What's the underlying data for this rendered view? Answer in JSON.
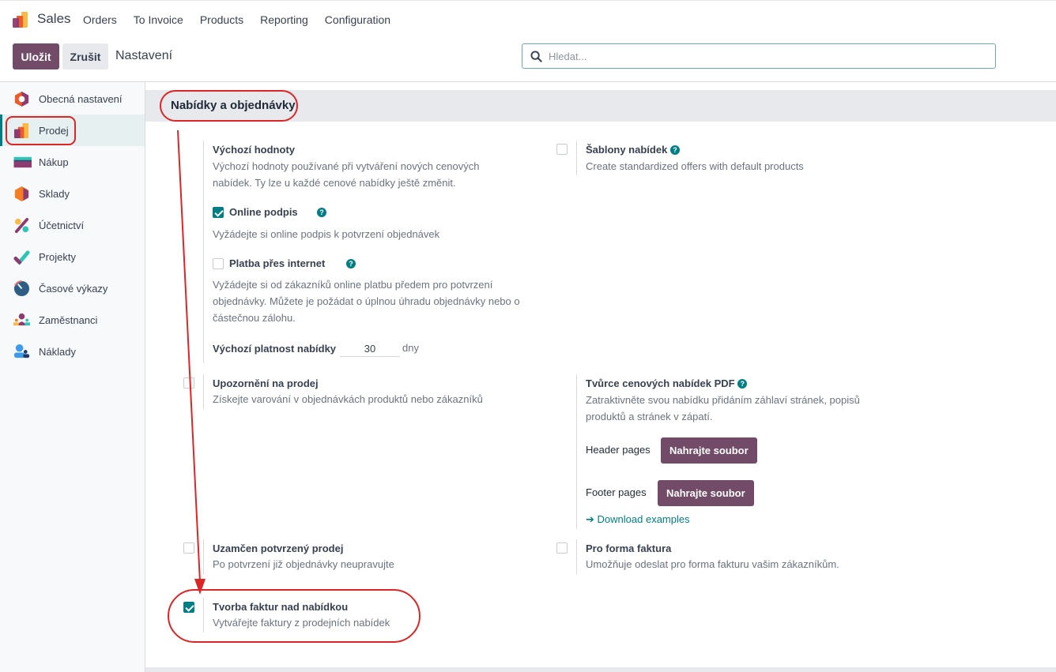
{
  "app": {
    "name": "Sales",
    "logo_icon": "sales-app-icon",
    "menu": [
      "Orders",
      "To Invoice",
      "Products",
      "Reporting",
      "Configuration"
    ]
  },
  "control_panel": {
    "save_label": "Uložit",
    "cancel_label": "Zrušit",
    "breadcrumb": "Nastavení",
    "search_placeholder": "Hledat...",
    "search_value": ""
  },
  "sidebar": {
    "active_index": 1,
    "items": [
      {
        "label": "Obecná nastavení",
        "icon": "general-settings-icon"
      },
      {
        "label": "Prodej",
        "icon": "sales-app-icon"
      },
      {
        "label": "Nákup",
        "icon": "purchase-app-icon"
      },
      {
        "label": "Sklady",
        "icon": "inventory-app-icon"
      },
      {
        "label": "Účetnictví",
        "icon": "accounting-app-icon"
      },
      {
        "label": "Projekty",
        "icon": "project-app-icon"
      },
      {
        "label": "Časové výkazy",
        "icon": "timesheets-app-icon"
      },
      {
        "label": "Zaměstnanci",
        "icon": "employees-app-icon"
      },
      {
        "label": "Náklady",
        "icon": "expenses-app-icon"
      }
    ]
  },
  "section": {
    "title": "Nabídky a objednávky"
  },
  "settings": {
    "defaults": {
      "title": "Výchozí hodnoty",
      "description": "Výchozí hodnoty používané při vytváření nových cenových nabídek. Ty lze u každé cenové nabídky ještě změnit.",
      "online_signature": {
        "label": "Online podpis",
        "checked": true,
        "description": "Vyžádejte si online podpis k potvrzení objednávek"
      },
      "online_payment": {
        "label": "Platba přes internet",
        "checked": false,
        "description": "Vyžádejte si od zákazníků online platbu předem pro potvrzení objednávky. Můžete je požádat o úplnou úhradu objednávky nebo o částečnou zálohu."
      },
      "validity": {
        "label": "Výchozí platnost nabídky",
        "value": "30",
        "unit": "dny"
      }
    },
    "quotation_templates": {
      "title": "Šablony nabídek",
      "checked": false,
      "description": "Create standardized offers with default products"
    },
    "sale_warnings": {
      "title": "Upozornění na prodej",
      "checked": false,
      "description": "Získejte varování v objednávkách produktů nebo zákazníků"
    },
    "pdf_builder": {
      "title": "Tvůrce cenových nabídek PDF",
      "description": "Zatraktivněte svou nabídku přidáním záhlaví stránek, popisů produktů a stránek v zápatí.",
      "header_label": "Header pages",
      "footer_label": "Footer pages",
      "upload_label": "Nahrajte soubor",
      "download_link": "Download examples"
    },
    "lock_confirmed": {
      "title": "Uzamčen potvrzený prodej",
      "checked": false,
      "description": "Po potvrzení již objednávky neupravujte"
    },
    "pro_forma": {
      "title": "Pro forma faktura",
      "checked": false,
      "description": "Umožňuje odeslat pro forma fakturu vašim zákazníkům."
    },
    "invoice_from_quote": {
      "title": "Tvorba faktur nad nabídkou",
      "checked": true,
      "description": "Vytvářejte faktury z prodejních nabídek"
    }
  },
  "colors": {
    "primary": "#714b67",
    "accent": "#017e84",
    "annotation": "#dc2626"
  }
}
